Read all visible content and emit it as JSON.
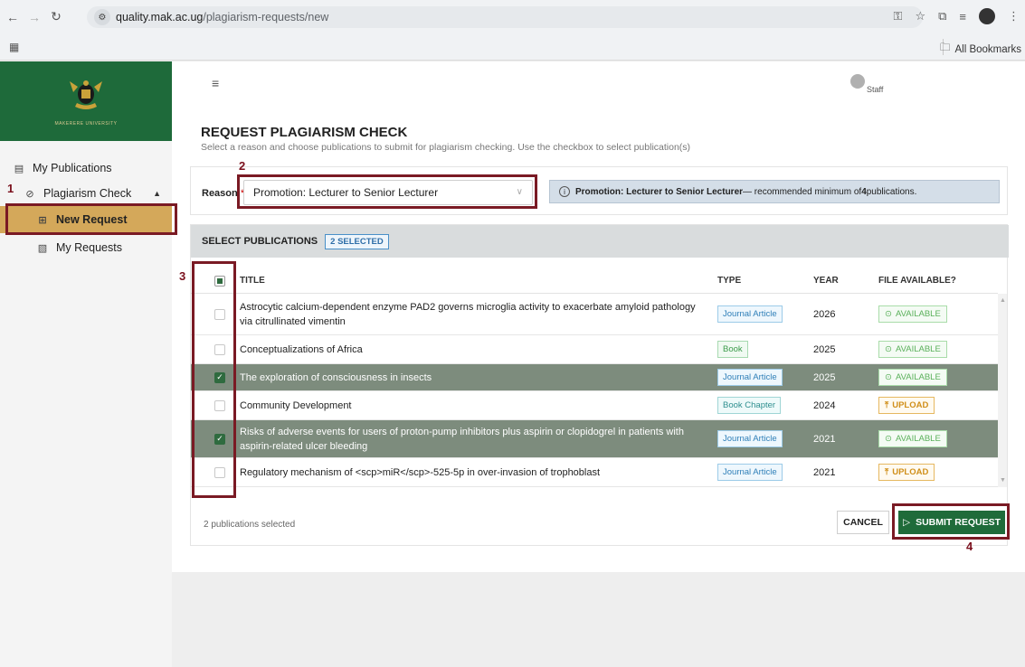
{
  "browser": {
    "url_domain": "quality.mak.ac.ug",
    "url_path": "/plagiarism-requests/new",
    "bookmarks_label": "All Bookmarks"
  },
  "sidebar": {
    "items": [
      {
        "label": "My Publications",
        "icon": "document-icon"
      },
      {
        "label": "Plagiarism Check",
        "icon": "shield-check-icon"
      },
      {
        "label": "New Request",
        "icon": "new-request-icon"
      },
      {
        "label": "My Requests",
        "icon": "requests-icon"
      }
    ]
  },
  "header": {
    "user_label": "Staff"
  },
  "page": {
    "title": "REQUEST PLAGIARISM CHECK",
    "subtitle": "Select a reason and choose publications to submit for plagiarism checking. Use the checkbox to select publication(s)"
  },
  "reason": {
    "label": "Reason",
    "required_mark": "*",
    "selected": "Promotion: Lecturer to Senior Lecturer",
    "info_bold": "Promotion: Lecturer to Senior Lecturer",
    "info_text": " — recommended minimum of ",
    "info_min": "4",
    "info_suffix": " publications."
  },
  "publications": {
    "header": "SELECT PUBLICATIONS",
    "badge": "2 SELECTED",
    "columns": [
      "TITLE",
      "TYPE",
      "YEAR",
      "FILE AVAILABLE?"
    ],
    "rows": [
      {
        "title": "Astrocytic calcium-dependent enzyme PAD2 governs microglia activity to exacerbate amyloid pathology via citrullinated vimentin",
        "type": "Journal Article",
        "year": "2026",
        "file": "AVAILABLE",
        "selected": false
      },
      {
        "title": "Conceptualizations of Africa",
        "type": "Book",
        "year": "2025",
        "file": "AVAILABLE",
        "selected": false
      },
      {
        "title": "The exploration of consciousness in insects",
        "type": "Journal Article",
        "year": "2025",
        "file": "AVAILABLE",
        "selected": true
      },
      {
        "title": "Community Development",
        "type": "Book Chapter",
        "year": "2024",
        "file": "UPLOAD",
        "selected": false
      },
      {
        "title": "Risks of adverse events for users of proton-pump inhibitors plus aspirin or clopidogrel in patients with aspirin-related ulcer bleeding",
        "type": "Journal Article",
        "year": "2021",
        "file": "AVAILABLE",
        "selected": true
      },
      {
        "title": "Regulatory mechanism of <scp>miR</scp>-525-5p in over-invasion of trophoblast",
        "type": "Journal Article",
        "year": "2021",
        "file": "UPLOAD",
        "selected": false
      }
    ],
    "selected_count_text": "2 publications selected"
  },
  "actions": {
    "cancel": "CANCEL",
    "submit": "SUBMIT REQUEST"
  },
  "annotations": [
    "1",
    "2",
    "3",
    "4"
  ],
  "colors": {
    "brand_green": "#1e6a3a",
    "active_item": "#d4a85a",
    "selected_row": "#7d8c7d",
    "annotation": "#7a1a24"
  }
}
